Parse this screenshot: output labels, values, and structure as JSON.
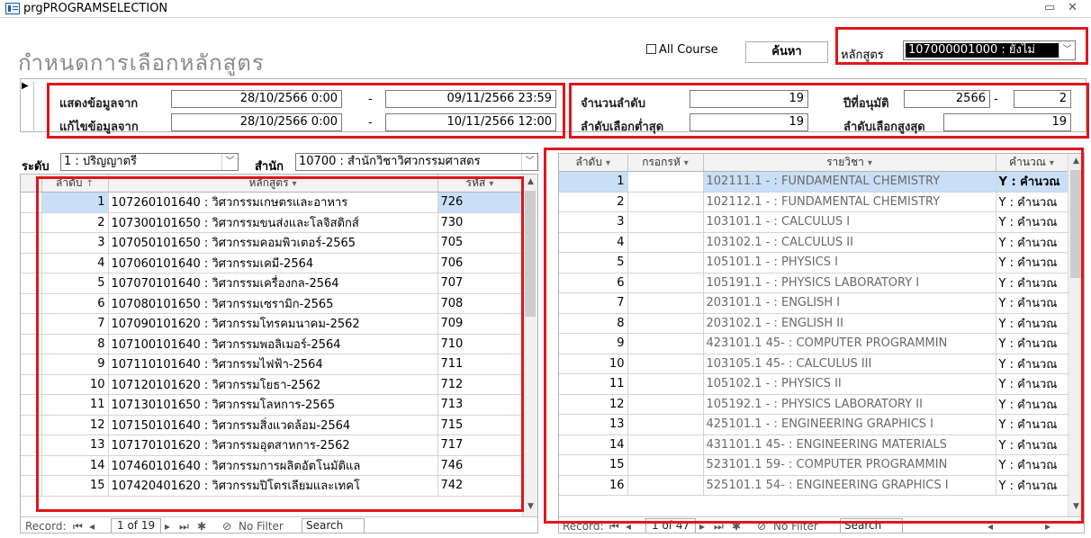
{
  "window": {
    "title": "prgPROGRAMSELECTION",
    "close_glyph": "✕",
    "minimize_glyph": "▭"
  },
  "header": {
    "title": "กำหนดการเลือกหลักสูตร",
    "all_course_label": "All Course",
    "search_button": "ค้นหา",
    "course_label": "หลักสูตร",
    "course_value": "107000001000 : ยังไม่"
  },
  "panel": {
    "show_from_label": "แสดงข้อมูลจาก",
    "show_from": "28/10/2566 0:00",
    "show_to": "09/11/2566 23:59",
    "edit_from_label": "แก้ไขข้อมูลจาก",
    "edit_from": "28/10/2566 0:00",
    "edit_to": "10/11/2566 12:00",
    "dash": "-",
    "count_label": "จำนวนลำดับ",
    "count_value": "19",
    "min_label": "ลำดับเลือกต่ำสุด",
    "min_value": "19",
    "year_label": "ปีที่อนุมัติ",
    "year_value": "2566",
    "year_value2": "2",
    "max_label": "ลำดับเลือกสูงสุด",
    "max_value": "19"
  },
  "filters": {
    "level_label": "ระดับ",
    "level_value": "1 : ปริญญาตรี",
    "office_label": "สำนัก",
    "office_value": "10700 : สำนักวิชาวิศวกรรมศาสตร"
  },
  "left_grid": {
    "headers": [
      "ลำดับ",
      "หลักสูตร",
      "รหัส"
    ],
    "rows": [
      {
        "no": "1",
        "course": "107260101640 : วิศวกรรมเกษตรและอาหาร",
        "code": "726"
      },
      {
        "no": "2",
        "course": "107300101650 : วิศวกรรมขนส่งและโลจิสติกส์",
        "code": "730"
      },
      {
        "no": "3",
        "course": "107050101650 : วิศวกรรมคอมพิวเตอร์-2565",
        "code": "705"
      },
      {
        "no": "4",
        "course": "107060101640 : วิศวกรรมเคมี-2564",
        "code": "706"
      },
      {
        "no": "5",
        "course": "107070101640 : วิศวกรรมเครื่องกล-2564",
        "code": "707"
      },
      {
        "no": "6",
        "course": "107080101650 : วิศวกรรมเซรามิก-2565",
        "code": "708"
      },
      {
        "no": "7",
        "course": "107090101620 : วิศวกรรมโทรคมนาคม-2562",
        "code": "709"
      },
      {
        "no": "8",
        "course": "107100101640 : วิศวกรรมพอลิเมอร์-2564",
        "code": "710"
      },
      {
        "no": "9",
        "course": "107110101640 : วิศวกรรมไฟฟ้า-2564",
        "code": "711"
      },
      {
        "no": "10",
        "course": "107120101620 : วิศวกรรมโยธา-2562",
        "code": "712"
      },
      {
        "no": "11",
        "course": "107130101650 : วิศวกรรมโลหการ-2565",
        "code": "713"
      },
      {
        "no": "12",
        "course": "107150101640 : วิศวกรรมสิ่งแวดล้อม-2564",
        "code": "715"
      },
      {
        "no": "13",
        "course": "107170101620 : วิศวกรรมอุตสาหการ-2562",
        "code": "717"
      },
      {
        "no": "14",
        "course": "107460101640 : วิศวกรรมการผลิตอัตโนมัติแล",
        "code": "746"
      },
      {
        "no": "15",
        "course": "107420401620 : วิศวกรรมปิโตรเลียมและเทคโ",
        "code": "742"
      }
    ],
    "nav": {
      "record_label": "Record:",
      "current": "1 of 19",
      "no_filter": "No Filter",
      "search": "Search"
    }
  },
  "right_grid": {
    "headers": [
      "ลำดับ",
      "กรอกรหั",
      "รายวิชา",
      "คำนวณ"
    ],
    "rows": [
      {
        "no": "1",
        "code": "",
        "subject": "102111.1  - : FUNDAMENTAL CHEMISTRY",
        "calc": "Y : คำนวณ"
      },
      {
        "no": "2",
        "code": "",
        "subject": "102112.1  - : FUNDAMENTAL CHEMISTRY",
        "calc": "Y : คำนวณ"
      },
      {
        "no": "3",
        "code": "",
        "subject": "103101.1  - : CALCULUS I",
        "calc": "Y : คำนวณ"
      },
      {
        "no": "4",
        "code": "",
        "subject": "103102.1  - : CALCULUS II",
        "calc": "Y : คำนวณ"
      },
      {
        "no": "5",
        "code": "",
        "subject": "105101.1  - : PHYSICS I",
        "calc": "Y : คำนวณ"
      },
      {
        "no": "6",
        "code": "",
        "subject": "105191.1  - : PHYSICS LABORATORY I",
        "calc": "Y : คำนวณ"
      },
      {
        "no": "7",
        "code": "",
        "subject": "203101.1  - : ENGLISH I",
        "calc": "Y : คำนวณ"
      },
      {
        "no": "8",
        "code": "",
        "subject": "203102.1  - : ENGLISH II",
        "calc": "Y : คำนวณ"
      },
      {
        "no": "9",
        "code": "",
        "subject": "423101.1  45- : COMPUTER PROGRAMMIN",
        "calc": "Y : คำนวณ"
      },
      {
        "no": "10",
        "code": "",
        "subject": "103105.1  45- : CALCULUS III",
        "calc": "Y : คำนวณ"
      },
      {
        "no": "11",
        "code": "",
        "subject": "105102.1  - : PHYSICS II",
        "calc": "Y : คำนวณ"
      },
      {
        "no": "12",
        "code": "",
        "subject": "105192.1  - : PHYSICS LABORATORY II",
        "calc": "Y : คำนวณ"
      },
      {
        "no": "13",
        "code": "",
        "subject": "425101.1  - : ENGINEERING GRAPHICS I",
        "calc": "Y : คำนวณ"
      },
      {
        "no": "14",
        "code": "",
        "subject": "431101.1  45- : ENGINEERING MATERIALS",
        "calc": "Y : คำนวณ"
      },
      {
        "no": "15",
        "code": "",
        "subject": "523101.1  59- : COMPUTER PROGRAMMIN",
        "calc": "Y : คำนวณ"
      },
      {
        "no": "16",
        "code": "",
        "subject": "525101.1  54- : ENGINEERING GRAPHICS I",
        "calc": "Y : คำนวณ"
      }
    ],
    "nav": {
      "record_label": "Record:",
      "current": "1 of 47",
      "no_filter": "No Filter",
      "search": "Search"
    }
  },
  "colors": {
    "highlight": "#e0161b",
    "selected_row": "#c9dff7"
  }
}
